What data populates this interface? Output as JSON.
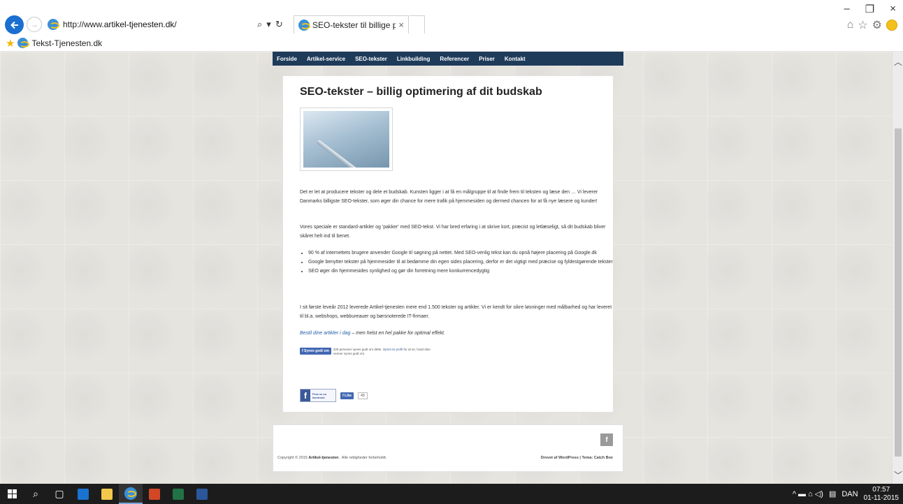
{
  "browser": {
    "url_prefix": "http://www.",
    "url_host": "artikel-tjenesten.dk",
    "url_suffix": "/",
    "tab_title": "SEO-tekster til billige priser...",
    "tab_close": "×",
    "favorites_item": "Tekst-Tjenesten.dk",
    "window_controls": {
      "minimize": "–",
      "restore": "❐",
      "close": "×"
    },
    "tools": {
      "search": "⌕",
      "dropdown": "▾",
      "refresh": "↻",
      "home": "⌂",
      "favorites": "☆",
      "settings": "⚙"
    }
  },
  "site": {
    "nav": [
      "Forside",
      "Artikel-service",
      "SEO-tekster",
      "Linkbuilding",
      "Referencer",
      "Priser",
      "Kontakt"
    ],
    "page_title": "SEO-tekster – billig optimering af dit budskab",
    "paragraph1": "Det er let at producere tekster og dele et budskab. Kunsten ligger i at få en målgruppe til at finde frem til teksten og læse den … Vi leverer Danmarks billigste SEO-tekster, som øger din chance for mere trafik på hjemmesiden og dermed chancen for at få nye læsere og kunder!",
    "paragraph2": "Vores speciale er standard-artikler og 'pakker' med SEO-tekst. Vi har bred erfaring i at skrive kort, præcist og letlæseligt, så dit budskab bliver skåret helt ind til benet.",
    "bullets": [
      "90 % af internettets brugere anvender Google til søgning på nettet. Med SEO-venlig tekst kan du opnå højere placering på Google.dk",
      "Google benytter tekster på hjemmesider til at bedømme din egen sides placering, derfor er det vigtigt med præcise og fyldestgørende tekster",
      "SEO øger din hjemmesides synlighed og gør din forretning mere konkurrencedygtig"
    ],
    "paragraph3": "I sit første leveår 2012 leverede Artikel-tjenesten mere end 1.500 tekster og artikler. Vi er kendt for sikre løsninger med målbarhed og har leveret til bl.a. webshops, webbureauer og børsnoterede IT-firmaer.",
    "cta_link": "Bestil dine artikler i dag",
    "cta_rest": " – men helst en hel pakke for optimal effekt.",
    "like_button": "f Synes godt om",
    "like_text": "329 personer synes godt om dette. ",
    "like_link": "Opret en profil",
    "like_text_end": " for at se, hvad dine venner synes godt om.",
    "fb_badge_line1": "Find us on",
    "fb_badge_line2": "facebook",
    "fb_like_small": "f Like",
    "fb_count": "43",
    "footer_fb": "f",
    "copyright_prefix": "Copyright © 2015 ",
    "copyright_name": "Artikel-tjenesten",
    "copyright_suffix": " . Alle rettigheder forbeholdt.",
    "credits": "Drevet af WordPress  |  Tema: Catch Box"
  },
  "taskbar": {
    "language": "DAN",
    "time": "07:57",
    "date": "01-11-2015",
    "tray_icons": "^  ▬  ⌂  ◁)"
  },
  "colors": {
    "nav_bg": "#1e3b5a",
    "link": "#1f5fa8",
    "facebook": "#3b5998",
    "ie_blue": "#1a6fd0"
  }
}
